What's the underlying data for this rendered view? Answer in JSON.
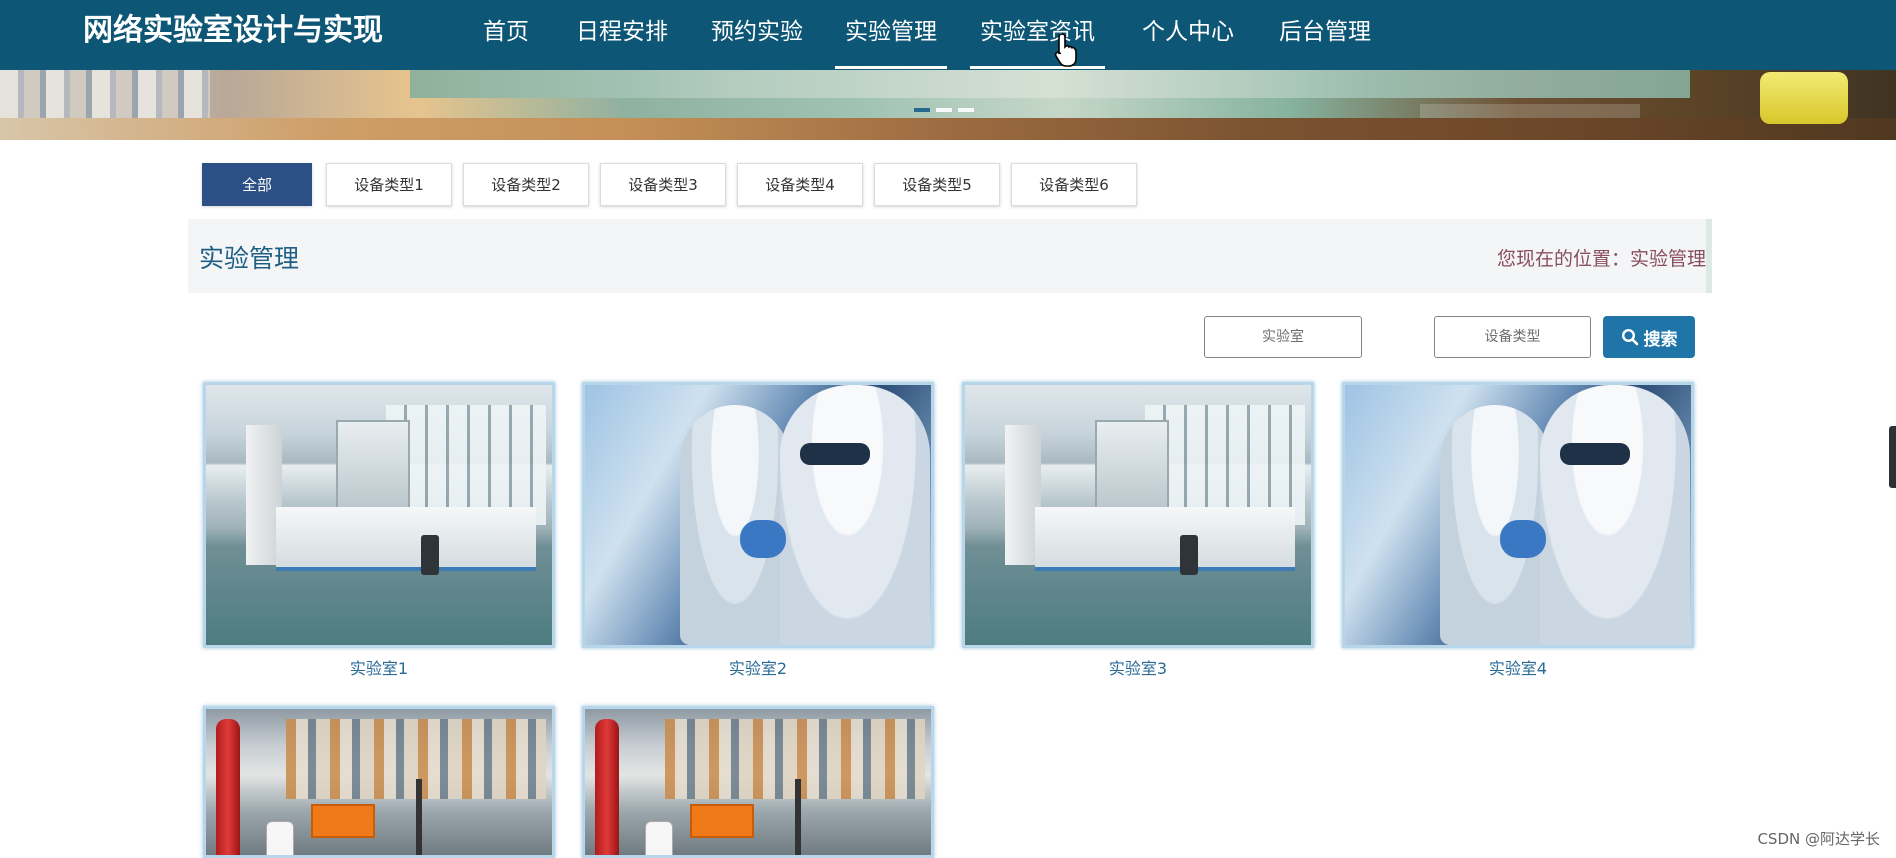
{
  "header": {
    "site_title": "网络实验室设计与实现",
    "nav": [
      {
        "label": "首页",
        "active": false
      },
      {
        "label": "日程安排",
        "active": false
      },
      {
        "label": "预约实验",
        "active": false
      },
      {
        "label": "实验管理",
        "active": true
      },
      {
        "label": "实验室资讯",
        "active": false,
        "hovered": true
      },
      {
        "label": "个人中心",
        "active": false
      },
      {
        "label": "后台管理",
        "active": false
      }
    ]
  },
  "banner": {
    "slides": 3,
    "active_slide": 1
  },
  "category_tabs": [
    {
      "label": "全部",
      "active": true
    },
    {
      "label": "设备类型1",
      "active": false
    },
    {
      "label": "设备类型2",
      "active": false
    },
    {
      "label": "设备类型3",
      "active": false
    },
    {
      "label": "设备类型4",
      "active": false
    },
    {
      "label": "设备类型5",
      "active": false
    },
    {
      "label": "设备类型6",
      "active": false
    }
  ],
  "section": {
    "title": "实验管理",
    "breadcrumb": "您现在的位置：实验管理"
  },
  "search": {
    "lab_placeholder": "实验室",
    "type_placeholder": "设备类型",
    "button_label": "搜索"
  },
  "labs": [
    {
      "name": "实验室1",
      "image": "empty-lab-room"
    },
    {
      "name": "实验室2",
      "image": "scientists-in-suits"
    },
    {
      "name": "实验室3",
      "image": "empty-lab-room"
    },
    {
      "name": "实验室4",
      "image": "scientists-in-suits"
    },
    {
      "name": "",
      "image": "lab-workshop"
    },
    {
      "name": "",
      "image": "lab-workshop"
    }
  ],
  "watermark": "CSDN @阿达学长",
  "colors": {
    "nav_bg": "#0d5675",
    "tab_active": "#2c4f85",
    "search_button": "#1f75a8",
    "caption": "#2a6a96",
    "breadcrumb": "#8a4f5c"
  }
}
